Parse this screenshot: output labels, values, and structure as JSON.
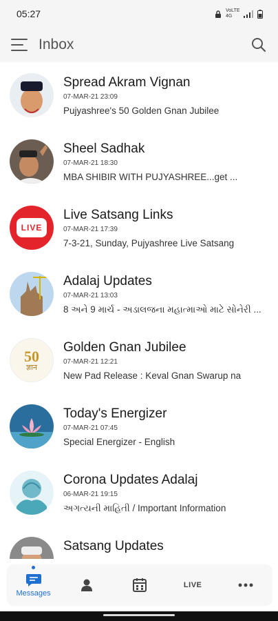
{
  "status": {
    "time": "05:27",
    "network": "VoLTE 4G"
  },
  "appbar": {
    "title": "Inbox"
  },
  "inbox": [
    {
      "name": "Spread Akram Vignan",
      "date": "07-MAR-21  23:09",
      "preview": "Pujyashree's 50 Golden Gnan Jubilee"
    },
    {
      "name": "Sheel Sadhak",
      "date": "07-MAR-21  18:30",
      "preview": "MBA SHIBIR WITH PUJYASHREE...get ..."
    },
    {
      "name": "Live Satsang Links",
      "date": "07-MAR-21  17:39",
      "preview": "7-3-21, Sunday, Pujyashree Live Satsang"
    },
    {
      "name": "Adalaj Updates",
      "date": "07-MAR-21  13:03",
      "preview": "8 અને 9 માર્ચ - અડાલજના મહાત્માઓ માટે સોનેરી ..."
    },
    {
      "name": "Golden Gnan Jubilee",
      "date": "07-MAR-21  12:21",
      "preview": "New Pad Release : Keval Gnan Swarup na"
    },
    {
      "name": "Today's Energizer",
      "date": "07-MAR-21  07:45",
      "preview": "Special Energizer - English"
    },
    {
      "name": "Corona Updates Adalaj",
      "date": "06-MAR-21  19:15",
      "preview": "અગત્યની માહિતી / Important Information"
    },
    {
      "name": "Satsang Updates",
      "date": "",
      "preview": ""
    }
  ],
  "avatars": {
    "live_badge": "LIVE",
    "jubilee_number": "50",
    "jubilee_word": "ज्ञान"
  },
  "nav": {
    "messages": "Messages",
    "live": "LIVE"
  },
  "colors": {
    "accent": "#1e6fd0",
    "live_red": "#e3242b"
  }
}
